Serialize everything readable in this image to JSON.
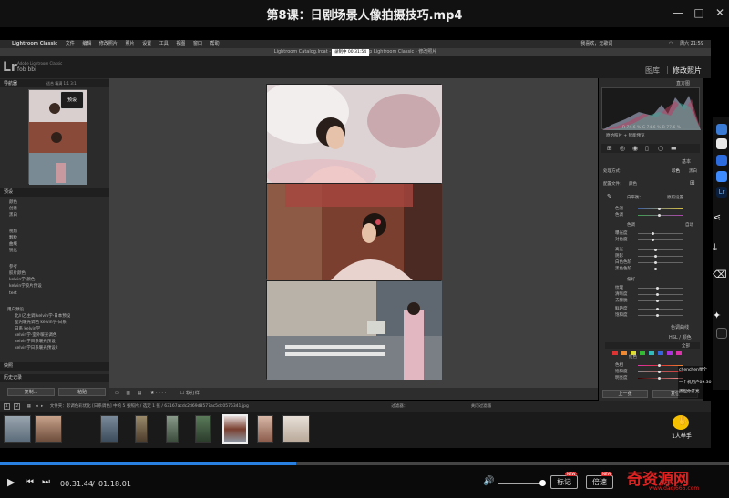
{
  "player": {
    "title": "第8课：日剧场景人像拍摄技巧.mp4",
    "time_current": "00:31:44",
    "time_total": "01:18:01",
    "progress_fraction": 0.406,
    "volume_fraction": 0.9,
    "buttons": [
      "标记",
      "倍速",
      "画质"
    ],
    "badges": [
      "NEW",
      "NEW"
    ]
  },
  "mac_menu": {
    "items": [
      "Lightroom Classic",
      "文件",
      "编辑",
      "修改照片",
      "照片",
      "设置",
      "工具",
      "视图",
      "窗口",
      "帮助"
    ],
    "right_text": "我喜欢，无歌词",
    "clock": "周六 21:59"
  },
  "lr": {
    "window_title": "Lightroom Catalog.lrcat - Adobe Photoshop Lightroom Classic - 修改照片",
    "rec_label": "录制中 00:31:54",
    "logo": "Lr",
    "subtitle": "Adobe Lightroom Classic",
    "user": "fob bbi",
    "modules": [
      "图库",
      "修改照片"
    ]
  },
  "left_panel": {
    "navigator": "导航器",
    "nav_zoom": "适合 填满 1:1 3:1",
    "nav_tag": "预设",
    "presets_header": "预设",
    "preset_groups": [
      [
        "颜色",
        "创意",
        "黑白"
      ],
      [
        "视角",
        "颗粒",
        "曲线",
        "锐化"
      ],
      [
        "参考",
        "胶片颜色",
        "kelvin学-颜色",
        "kelvin学胶片预设"
      ],
      [
        "test"
      ]
    ],
    "user_presets_header": "用户预设",
    "user_presets": [
      "北川乙主调 kelvin学-日本预设",
      "室内暖光调色 kelvin学-日系",
      "日系 kelvin学",
      "kelvin学-室外暖光调色",
      "kelvin学日系暖光预设",
      "kelvin学日系暖光预设2"
    ],
    "snapshot": "快照",
    "history": "历史记录",
    "copy_btn": "复制...",
    "paste_btn": "粘贴"
  },
  "toolbar": {
    "soft_proof": "软打样"
  },
  "right_panel": {
    "panel_title": "直方图",
    "histo_values": "R 74.6 %  G 74.6 %  B 77.6 %",
    "orig_label": "原始照片 + 智能预览",
    "basic": "基本",
    "treatment_label": "处理方式：",
    "treatment_color": "彩色",
    "treatment_bw": "黑白",
    "profile_label": "配置文件：",
    "profile_value": "颜色",
    "wb_label": "白平衡：",
    "wb_value": "原照设置",
    "temp": "色温",
    "tint": "色调",
    "tone": "色调",
    "auto": "自动",
    "exposure": "曝光度",
    "contrast": "对比度",
    "highlights": "高光",
    "shadows": "阴影",
    "whites": "白色色阶",
    "blacks": "黑色色阶",
    "presence": "偏好",
    "texture": "纹理",
    "clarity": "清晰度",
    "dehaze": "去朦胧",
    "vibrance": "鲜艳度",
    "saturation": "饱和度",
    "tone_curve": "色调曲线",
    "hsl": "HSL / 颜色",
    "hsl_tab": "全部",
    "red": "红色",
    "hue": "色相",
    "sat": "饱和度",
    "lum": "明亮度",
    "prev_btn": "上一张",
    "reset_btn": "复位"
  },
  "filmstrip": {
    "bar_text": "文件夹：影调色彩优化 [日系调色] 中的 5 张照片 / 选定 1 张 / 63167acdc2d69d8577ac5dc0575341.jpg",
    "filter_label": "过滤器：",
    "filter_value": "关闭过滤器",
    "thumb_count": 8
  },
  "overlay": {
    "chat_user": "chenchen举个",
    "chat_line": "一个机用户09:30",
    "chat_note": "黑但你开亮",
    "raise_hand": "1人举手"
  },
  "watermark": {
    "text": "奇资源网",
    "url": "www.daqi666.com"
  },
  "colors": {
    "accent_blue": "#2a80e0",
    "badge_red": "#e02a2a"
  }
}
